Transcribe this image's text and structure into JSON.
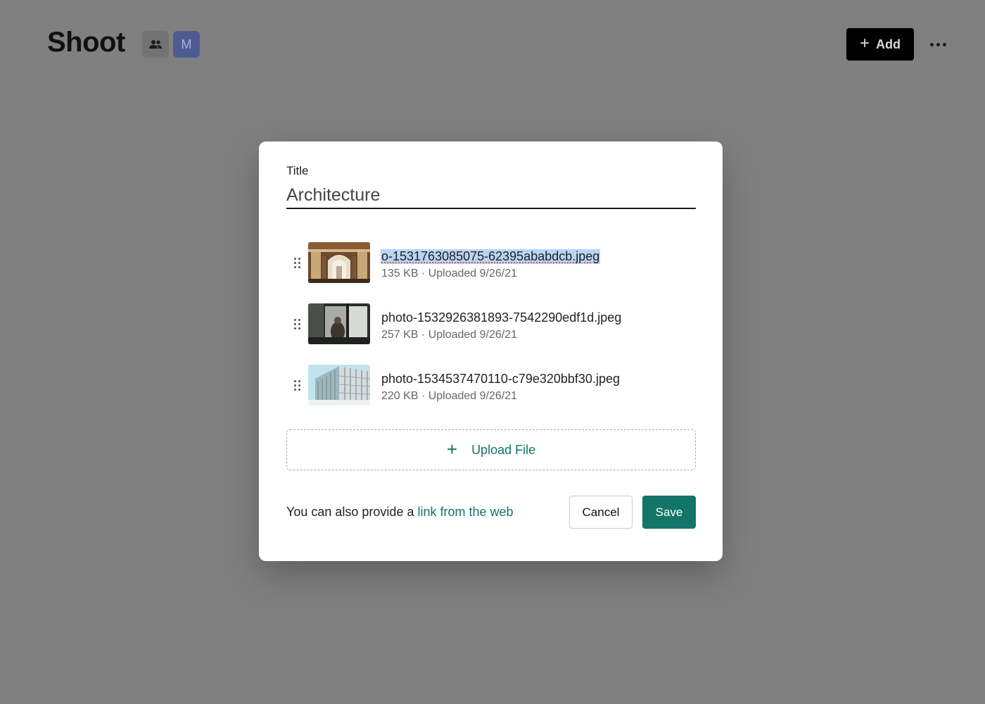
{
  "header": {
    "title": "Shoot",
    "avatar_initial": "M",
    "add_label": "Add",
    "accent_color": "#000000"
  },
  "modal": {
    "title_label": "Title",
    "title_value": "Architecture",
    "files": [
      {
        "name": "o-1531763085075-62395ababdcb.jpeg",
        "meta": "135 KB · Uploaded 9/26/21",
        "selected": true
      },
      {
        "name": "photo-1532926381893-7542290edf1d.jpeg",
        "meta": "257 KB · Uploaded 9/26/21",
        "selected": false
      },
      {
        "name": "photo-1534537470110-c79e320bbf30.jpeg",
        "meta": "220 KB · Uploaded 9/26/21",
        "selected": false
      }
    ],
    "upload_label": "Upload File",
    "footer_text": "You can also provide a",
    "footer_link": "link from the web",
    "cancel_label": "Cancel",
    "save_label": "Save",
    "primary_color": "#137567",
    "selection_color": "#b9d5f5"
  }
}
